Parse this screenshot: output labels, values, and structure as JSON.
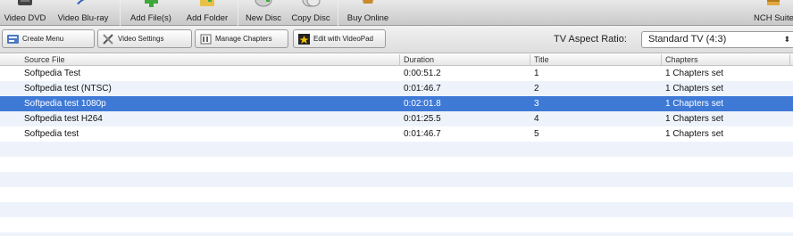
{
  "toolbar": {
    "buttons": [
      {
        "label": "Video DVD",
        "icon": "dvd-icon"
      },
      {
        "label": "Video Blu-ray",
        "icon": "bluray-icon"
      },
      {
        "label": "Add File(s)",
        "icon": "add-file-icon"
      },
      {
        "label": "Add Folder",
        "icon": "add-folder-icon"
      },
      {
        "label": "New Disc",
        "icon": "new-disc-icon"
      },
      {
        "label": "Copy Disc",
        "icon": "copy-disc-icon"
      },
      {
        "label": "Buy Online",
        "icon": "cart-icon"
      },
      {
        "label": "NCH Suite",
        "icon": "nch-suite-icon"
      }
    ]
  },
  "subbar": {
    "create_menu": "Create Menu",
    "video_settings": "Video Settings",
    "manage_chapters": "Manage Chapters",
    "edit_videopad": "Edit with VideoPad",
    "aspect_label": "TV Aspect Ratio:",
    "aspect_value": "Standard TV (4:3)"
  },
  "table": {
    "columns": [
      "Source File",
      "Duration",
      "Title",
      "Chapters"
    ],
    "rows": [
      {
        "source": "Softpedia Test",
        "duration": "0:00:51.2",
        "title": "1",
        "chapters": "1 Chapters set"
      },
      {
        "source": "Softpedia test (NTSC)",
        "duration": "0:01:46.7",
        "title": "2",
        "chapters": "1 Chapters set"
      },
      {
        "source": "Softpedia test 1080p",
        "duration": "0:02:01.8",
        "title": "3",
        "chapters": "1 Chapters set",
        "selected": true
      },
      {
        "source": "Softpedia test H264",
        "duration": "0:01:25.5",
        "title": "4",
        "chapters": "1 Chapters set"
      },
      {
        "source": "Softpedia test",
        "duration": "0:01:46.7",
        "title": "5",
        "chapters": "1 Chapters set"
      }
    ]
  },
  "colors": {
    "selection": "#3e79d6",
    "alt_row": "#eef3fb"
  }
}
